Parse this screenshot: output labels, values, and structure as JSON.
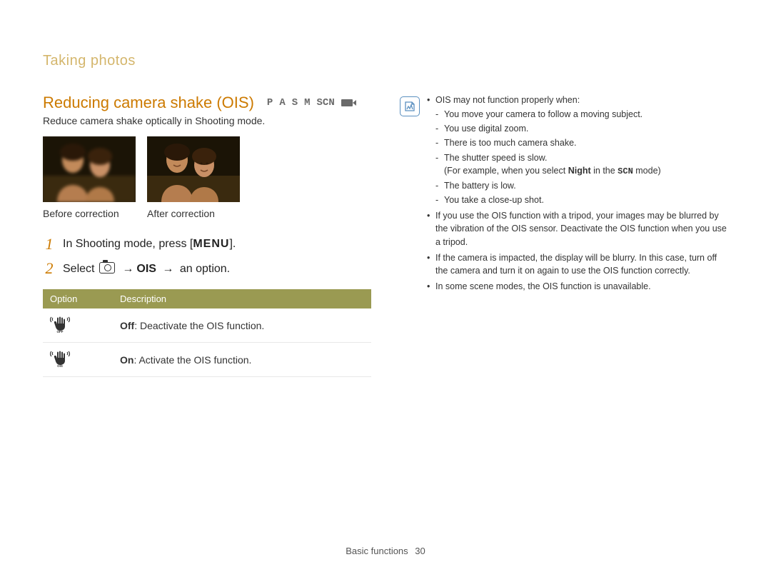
{
  "breadcrumb": "Taking photos",
  "title": "Reducing camera shake (OIS)",
  "modes": [
    "P",
    "A",
    "S",
    "M",
    "SCN"
  ],
  "subtitle": "Reduce camera shake optically in Shooting mode.",
  "captions": {
    "before": "Before correction",
    "after": "After correction"
  },
  "steps": {
    "s1_prefix": "In Shooting mode, press [",
    "s1_menu": "MENU",
    "s1_suffix": "].",
    "s2_prefix": "Select ",
    "s2_arrow": "→",
    "s2_ois": "OIS",
    "s2_suffix": " an option."
  },
  "table": {
    "head_option": "Option",
    "head_desc": "Description",
    "rows": [
      {
        "label_bold": "Off",
        "label_rest": ": Deactivate the OIS function.",
        "icon_sub": "OFF"
      },
      {
        "label_bold": "On",
        "label_rest": ": Activate the OIS function.",
        "icon_sub": "OIS"
      }
    ]
  },
  "info": {
    "b1": "OIS may not function properly when:",
    "b1_subs": [
      "You move your camera to follow a moving subject.",
      "You use digital zoom.",
      "There is too much camera shake.",
      "The shutter speed is slow."
    ],
    "b1_sub_for_example_pre": "(For example, when you select ",
    "b1_sub_for_example_bold": "Night",
    "b1_sub_for_example_mid": " in the ",
    "b1_sub_for_example_scn": "SCN",
    "b1_sub_for_example_post": " mode)",
    "b1_subs2": [
      "The battery is low.",
      "You take a close-up shot."
    ],
    "b2": "If you use the OIS function with a tripod, your images may be blurred by the vibration of the OIS sensor. Deactivate the OIS function when you use a tripod.",
    "b3": "If the camera is impacted, the display will be blurry. In this case, turn off the camera and turn it on again to use the OIS function correctly.",
    "b4": "In some scene modes, the OIS function is unavailable."
  },
  "footer": {
    "section": "Basic functions",
    "page": "30"
  }
}
